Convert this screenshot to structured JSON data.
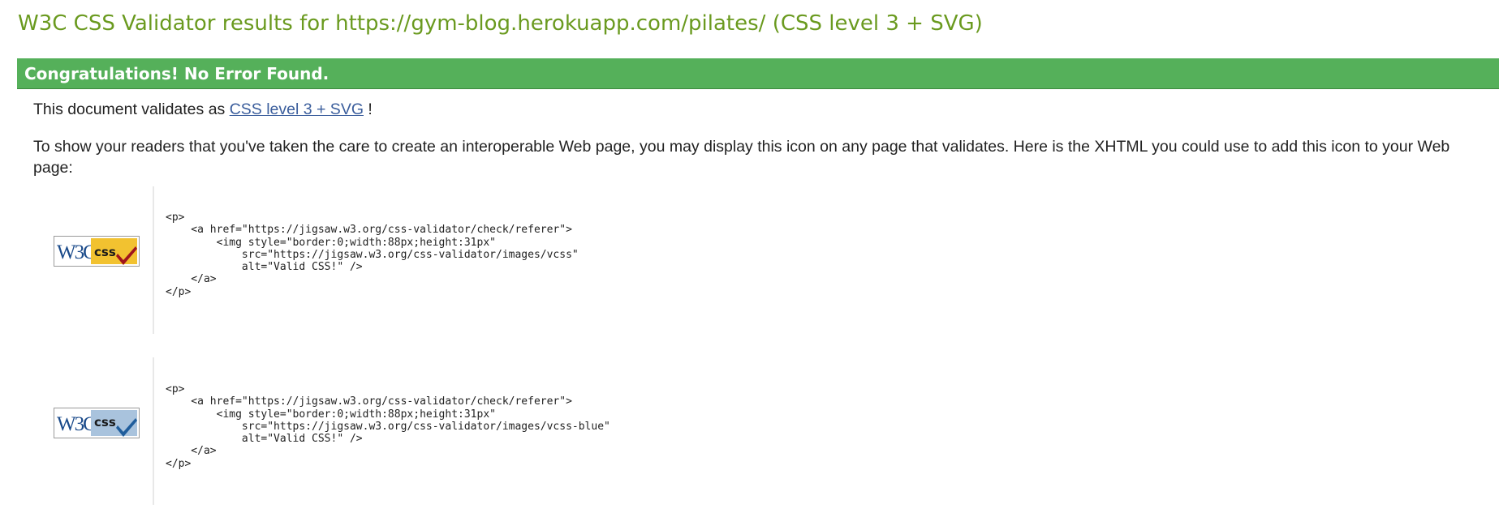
{
  "page": {
    "title": "W3C CSS Validator results for https://gym-blog.herokuapp.com/pilates/ (CSS level 3 + SVG)"
  },
  "banner": {
    "text": "Congratulations! No Error Found."
  },
  "validation": {
    "prefix": "This document validates as ",
    "link_text": "CSS level 3 + SVG",
    "suffix": " !"
  },
  "info": {
    "text": "To show your readers that you've taken the care to create an interoperable Web page, you may display this icon on any page that validates. Here is the XHTML you could use to add this icon to your Web page:"
  },
  "badges": [
    {
      "name": "W3C CSS valid badge (gold)",
      "logo_text": "W3C",
      "label": "css",
      "panel_color": "#f2c230",
      "check_color": "#a0151b",
      "code": "<p>\n    <a href=\"https://jigsaw.w3.org/css-validator/check/referer\">\n        <img style=\"border:0;width:88px;height:31px\"\n            src=\"https://jigsaw.w3.org/css-validator/images/vcss\"\n            alt=\"Valid CSS!\" />\n    </a>\n</p>"
    },
    {
      "name": "W3C CSS valid badge (blue)",
      "logo_text": "W3C",
      "label": "css",
      "panel_color": "#a9c3dd",
      "check_color": "#1f5d9c",
      "code": "<p>\n    <a href=\"https://jigsaw.w3.org/css-validator/check/referer\">\n        <img style=\"border:0;width:88px;height:31px\"\n            src=\"https://jigsaw.w3.org/css-validator/images/vcss-blue\"\n            alt=\"Valid CSS!\" />\n    </a>\n</p>"
    }
  ],
  "colors": {
    "title": "#6a9a1f",
    "banner_bg": "#55b05a",
    "link": "#3a5d9c"
  }
}
